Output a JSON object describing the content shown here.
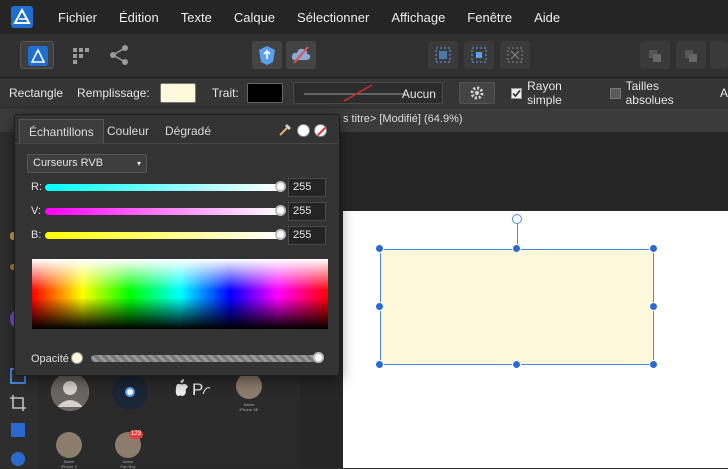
{
  "menu": {
    "items": [
      "Fichier",
      "Édition",
      "Texte",
      "Calque",
      "Sélectionner",
      "Affichage",
      "Fenêtre",
      "Aide"
    ]
  },
  "context_bar": {
    "tool_name": "Rectangle",
    "fill_label": "Remplissage:",
    "fill_color": "#fff9dc",
    "stroke_label": "Trait:",
    "stroke_color": "#000000",
    "stroke_style_value": "Aucun",
    "radius_label": "Rayon simple",
    "radius_checked": true,
    "absolute_sizes_label": "Tailles absolues",
    "absolute_sizes_checked": false,
    "overflow_letter": "A"
  },
  "document": {
    "tab_title": "s titre> [Modifié] (64.9%)"
  },
  "color_popover": {
    "tabs": [
      "Échantillons",
      "Couleur",
      "Dégradé"
    ],
    "active_tab": "Échantillons",
    "mode_select": "Curseurs RVB",
    "sliders": [
      {
        "label": "R:",
        "value": "255",
        "level": 1.0
      },
      {
        "label": "V:",
        "value": "255",
        "level": 1.0
      },
      {
        "label": "B:",
        "value": "255",
        "level": 1.0
      }
    ],
    "opacity_label": "Opacité",
    "opacity_level": 1.0
  },
  "assets": {
    "items": [
      {
        "label": ""
      },
      {
        "label": ""
      },
      {
        "label": ""
      },
      {
        "label": "Name\niPhone SE"
      },
      {
        "label": "Name\niPhone X"
      },
      {
        "label": "Name\nFan Boy",
        "badge": "123"
      }
    ]
  },
  "colors": {
    "accent": "#2a6ad0",
    "shape_fill": "#fff9dc",
    "selection": "#4a8ae6"
  }
}
